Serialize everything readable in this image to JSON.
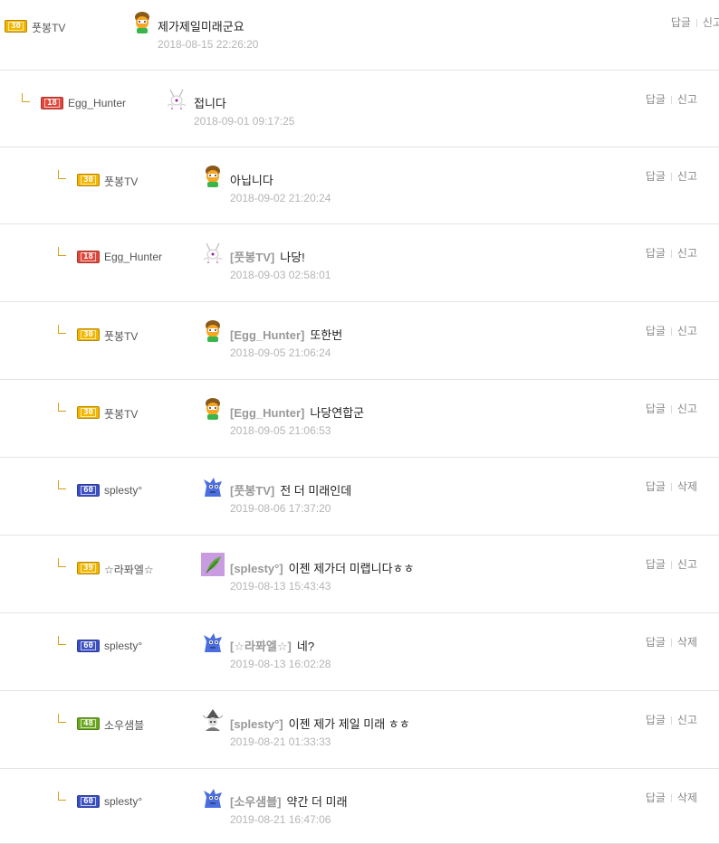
{
  "actions": {
    "reply": "답글",
    "report": "신고",
    "delete": "삭제"
  },
  "level_colors": {
    "30": "#f2b500",
    "18": "#e2473b",
    "60": "#3b4fc4",
    "39": "#f2b500",
    "48": "#6aa81f"
  },
  "comments": [
    {
      "level": "30",
      "nick": "풋봉TV",
      "avatar": "mushroom-hat-avatar-icon",
      "mention": "",
      "text": "제가제일미래군요",
      "date": "2018-08-15 22:26:20",
      "action2": "신고"
    },
    {
      "level": "18",
      "nick": "Egg_Hunter",
      "avatar": "bunny-sprite-avatar-icon",
      "mention": "",
      "text": "접니다",
      "date": "2018-09-01 09:17:25",
      "action2": "신고"
    },
    {
      "level": "30",
      "nick": "풋봉TV",
      "avatar": "mushroom-hat-avatar-icon",
      "mention": "",
      "text": "아닙니다",
      "date": "2018-09-02 21:20:24",
      "action2": "신고"
    },
    {
      "level": "18",
      "nick": "Egg_Hunter",
      "avatar": "bunny-sprite-avatar-icon",
      "mention": "[풋봉TV]",
      "text": "나당!",
      "date": "2018-09-03 02:58:01",
      "action2": "신고"
    },
    {
      "level": "30",
      "nick": "풋봉TV",
      "avatar": "mushroom-hat-avatar-icon",
      "mention": "[Egg_Hunter]",
      "text": "또한번",
      "date": "2018-09-05 21:06:24",
      "action2": "신고"
    },
    {
      "level": "30",
      "nick": "풋봉TV",
      "avatar": "mushroom-hat-avatar-icon",
      "mention": "[Egg_Hunter]",
      "text": "나당연합군",
      "date": "2018-09-05 21:06:53",
      "action2": "신고"
    },
    {
      "level": "60",
      "nick": "splesty°",
      "avatar": "blue-dragon-avatar-icon",
      "mention": "[풋봉TV]",
      "text": "전 더 미래인데",
      "date": "2019-08-06 17:37:20",
      "action2": "삭제"
    },
    {
      "level": "39",
      "nick": "☆라퐈엘☆",
      "avatar": "feather-avatar-icon",
      "mention": "[splesty°]",
      "text": "이젠 제가더 미랩니다ㅎㅎ",
      "date": "2019-08-13 15:43:43",
      "action2": "신고"
    },
    {
      "level": "60",
      "nick": "splesty°",
      "avatar": "blue-dragon-avatar-icon",
      "mention": "[☆라퐈엘☆]",
      "text": "네?",
      "date": "2019-08-13 16:02:28",
      "action2": "삭제"
    },
    {
      "level": "48",
      "nick": "소우샘블",
      "avatar": "wizard-avatar-icon",
      "mention": "[splesty°]",
      "text": "이젠 제가 제일 미래 ㅎㅎ",
      "date": "2019-08-21 01:33:33",
      "action2": "신고"
    },
    {
      "level": "60",
      "nick": "splesty°",
      "avatar": "blue-dragon-avatar-icon",
      "mention": "[소우샘블]",
      "text": "약간 더 미래",
      "date": "2019-08-21 16:47:06",
      "action2": "삭제"
    }
  ]
}
